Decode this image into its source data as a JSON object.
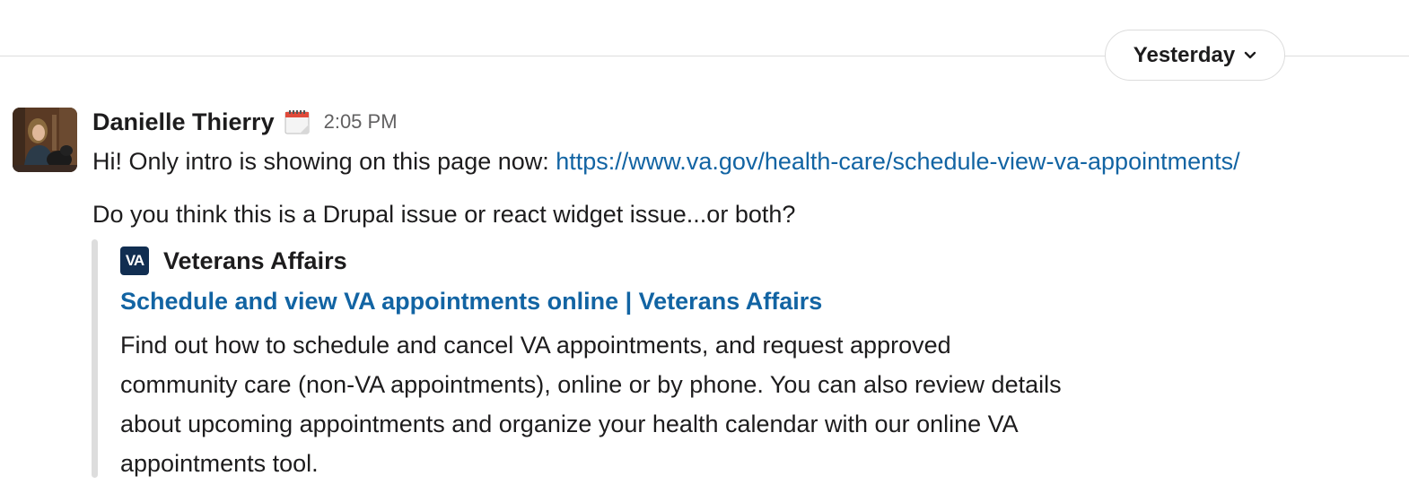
{
  "divider": {
    "date_label": "Yesterday",
    "chevron_icon": "chevron-down-icon"
  },
  "message": {
    "sender": "Danielle Thierry",
    "status_emoji": "calendar-icon",
    "time": "2:05 PM",
    "text_prefix": "Hi! Only intro is showing on this page now: ",
    "link": "https://www.va.gov/health-care/schedule-view-va-appointments/",
    "text_line2": "Do you think this is a Drupal issue or react widget issue...or both?"
  },
  "unfurl": {
    "logo_text": "VA",
    "source": "Veterans Affairs",
    "title": "Schedule and view VA appointments online | Veterans Affairs",
    "description_lines": [
      "Find out how to schedule and cancel VA appointments, and request approved",
      "community care (non-VA appointments), online or by phone. You can also review details",
      "about upcoming appointments and organize your health calendar with our online VA",
      "appointments tool."
    ]
  },
  "colors": {
    "link": "#1264a3",
    "text": "#1d1c1d",
    "muted": "#616061",
    "va_brand": "#112e51",
    "attachment_bar": "#dddddd"
  }
}
